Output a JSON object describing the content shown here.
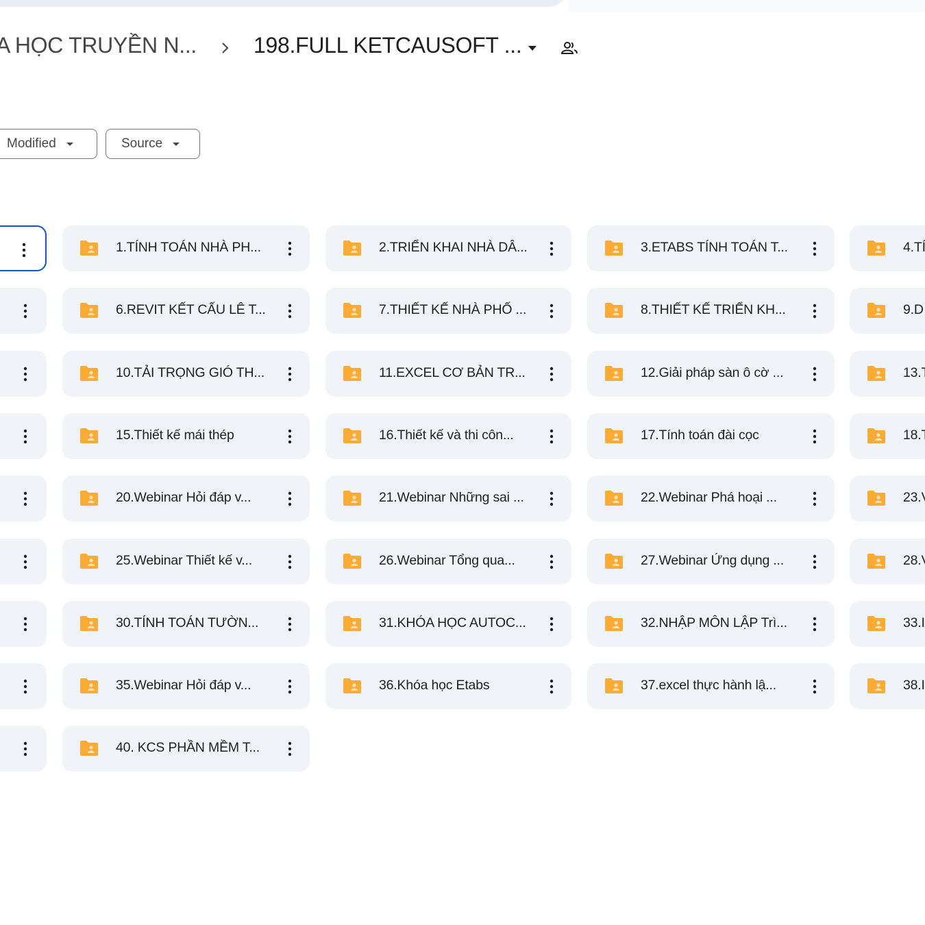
{
  "breadcrumb": {
    "parent": "A HỌC TRUYỀN N...",
    "current": "198.FULL KETCAUSOFT ..."
  },
  "filters": [
    {
      "label": "Modified"
    },
    {
      "label": "Source"
    }
  ],
  "icons": {
    "folder_color": "#f9ab36",
    "folder_person_color": "#fce3b8",
    "selected_border": "#0b57d0",
    "card_background": "#f0f4f9"
  },
  "folders": {
    "col1": [
      "1.TÍNH TOÁN NHÀ PH...",
      "6.REVIT KẾT CẤU LÊ T...",
      "10.TẢI TRỌNG GIÓ TH...",
      "15.Thiết kế mái thép",
      "20.Webinar Hỏi đáp v...",
      "25.Webinar Thiết kế v...",
      "30.TÍNH TOÁN TƯỜN...",
      "35.Webinar Hỏi đáp v...",
      "40. KCS PHẦN MỀM T..."
    ],
    "col2": [
      "2.TRIỂN KHAI NHÀ DÂ...",
      "7.THIẾT KẾ NHÀ PHỐ ...",
      "11.EXCEL CƠ BẢN TR...",
      "16.Thiết kế và thi côn...",
      "21.Webinar Những sai ...",
      "26.Webinar Tổng qua...",
      "31.KHÓA HỌC AUTOC...",
      "36.Khóa học Etabs"
    ],
    "col3": [
      "3.ETABS TÍNH TOÁN T...",
      "8.THIẾT KẾ TRIỂN KH...",
      "12.Giải pháp sàn ô cờ ...",
      "17.Tính toán đài cọc",
      "22.Webinar Phá hoại ...",
      "27.Webinar Ứng dụng ...",
      "32.NHẬP MÔN LẬP Trì...",
      "37.excel thực hành lậ..."
    ],
    "col4": [
      "4.TÍ",
      "9.D",
      "13.T",
      "18.T",
      "23.V",
      "28.V",
      "33.I",
      "38.I"
    ]
  }
}
